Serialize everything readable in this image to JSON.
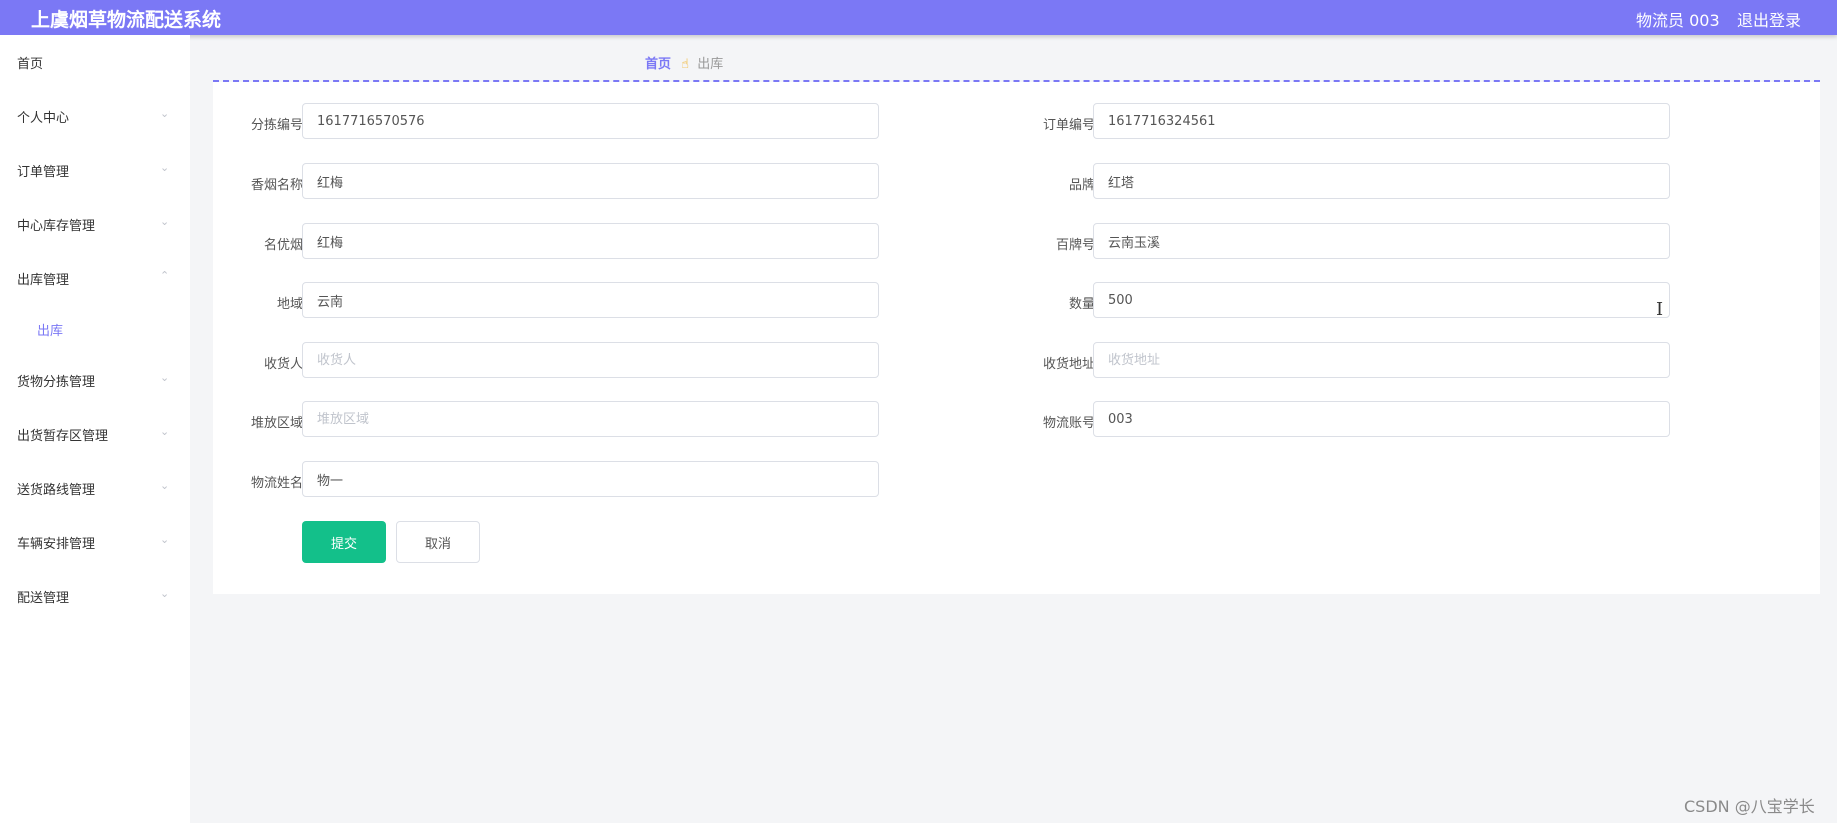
{
  "header": {
    "app_title": "上虞烟草物流配送系统",
    "user_label": "物流员 003",
    "logout_label": "退出登录"
  },
  "sidebar": {
    "items": [
      {
        "label": "首页",
        "expandable": false
      },
      {
        "label": "个人中心",
        "expandable": true
      },
      {
        "label": "订单管理",
        "expandable": true
      },
      {
        "label": "中心库存管理",
        "expandable": true
      },
      {
        "label": "出库管理",
        "expandable": true,
        "expanded": true,
        "sub_items": [
          {
            "label": "出库",
            "active": true
          }
        ]
      },
      {
        "label": "货物分拣管理",
        "expandable": true
      },
      {
        "label": "出货暂存区管理",
        "expandable": true
      },
      {
        "label": "送货路线管理",
        "expandable": true
      },
      {
        "label": "车辆安排管理",
        "expandable": true
      },
      {
        "label": "配送管理",
        "expandable": true
      }
    ]
  },
  "breadcrumb": {
    "home": "首页",
    "current": "出库",
    "separator_icon": "hand-pointer-icon"
  },
  "form": {
    "sort_no": {
      "label": "分拣编号",
      "value": "1617716570576",
      "placeholder": "分拣编号"
    },
    "order_no": {
      "label": "订单编号",
      "value": "1617716324561",
      "placeholder": "订单编号"
    },
    "cigarette": {
      "label": "香烟名称",
      "value": "红梅",
      "placeholder": "香烟名称"
    },
    "brand": {
      "label": "品牌",
      "value": "红塔",
      "placeholder": "品牌"
    },
    "famous": {
      "label": "名优烟",
      "value": "红梅",
      "placeholder": "名优烟"
    },
    "top_brand_no": {
      "label": "百牌号",
      "value": "云南玉溪",
      "placeholder": "百牌号"
    },
    "region": {
      "label": "地域",
      "value": "云南",
      "placeholder": "地域"
    },
    "quantity": {
      "label": "数量",
      "value": "500",
      "placeholder": "数量"
    },
    "receiver": {
      "label": "收货人",
      "value": "",
      "placeholder": "收货人"
    },
    "address": {
      "label": "收货地址",
      "value": "",
      "placeholder": "收货地址"
    },
    "storage_area": {
      "label": "堆放区域",
      "value": "",
      "placeholder": "堆放区域"
    },
    "logistics_account": {
      "label": "物流账号",
      "value": "003",
      "placeholder": "物流账号"
    },
    "logistics_name": {
      "label": "物流姓名",
      "value": "物一",
      "placeholder": "物流姓名"
    },
    "submit_label": "提交",
    "cancel_label": "取消"
  },
  "watermark": "CSDN @八宝学长",
  "colors": {
    "accent": "#7b78f5",
    "submit": "#13c08a",
    "page_bg": "#f4f5f7"
  }
}
